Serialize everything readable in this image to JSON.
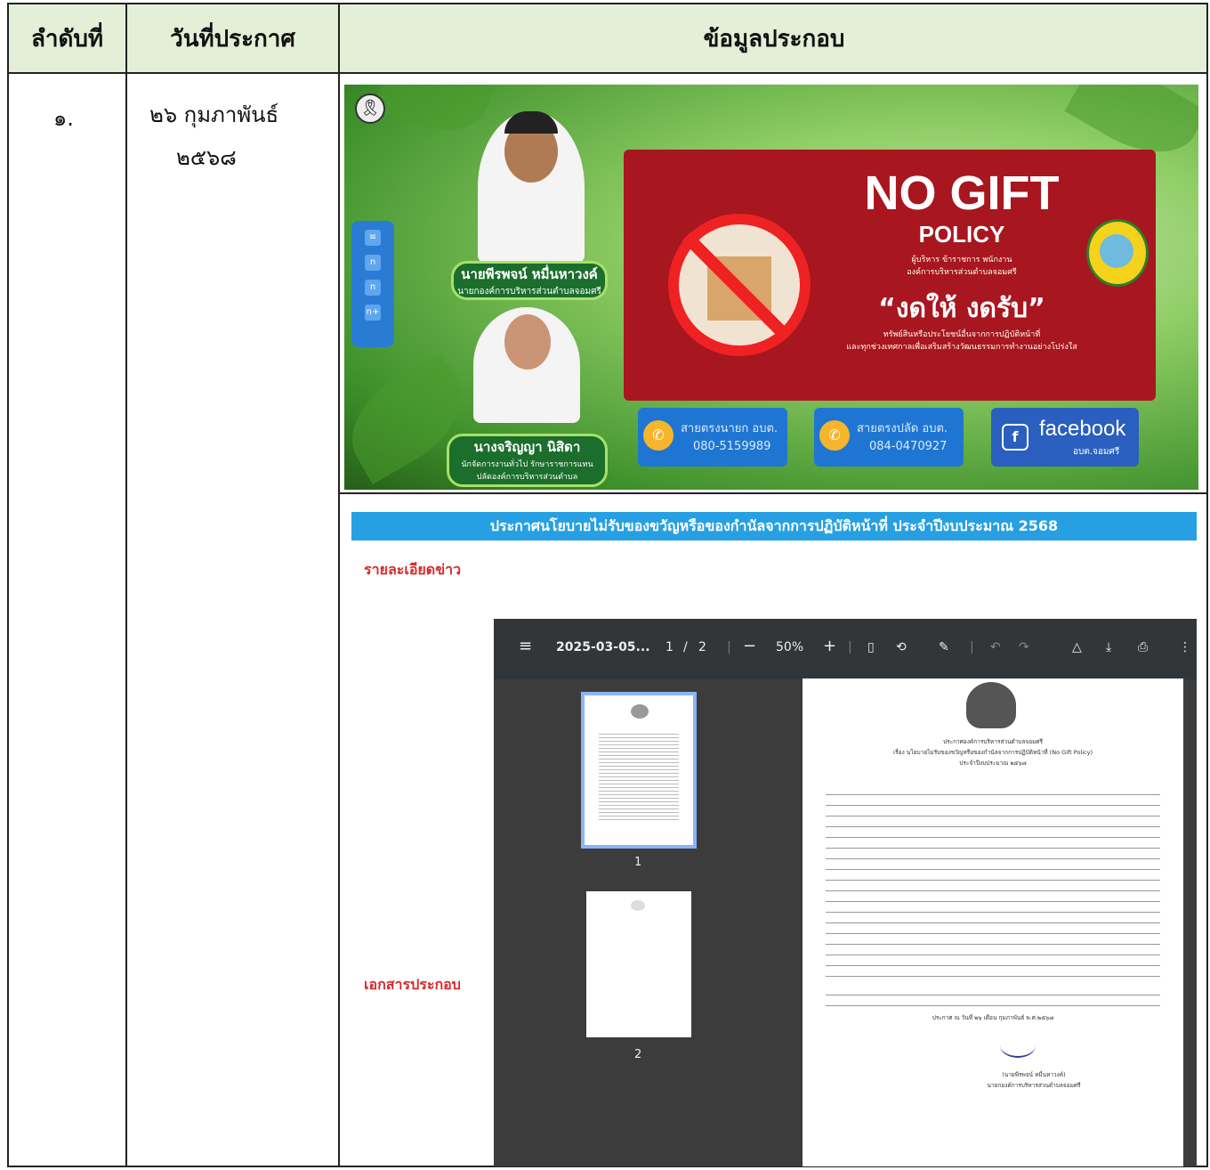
{
  "table": {
    "headers": {
      "no": "ลำดับที่",
      "date": "วันที่ประกาศ",
      "info": "ข้อมูลประกอบ"
    },
    "row": {
      "no": "๑.",
      "date_line1": "๒๖ กุมภาพันธ์",
      "date_line2": "๒๕๖๘"
    }
  },
  "banner": {
    "person1_name": "นายพีรพจน์ หมื่นหาวงค์",
    "person1_title": "นายกองค์การบริหารส่วนตำบลจอมศรี",
    "person2_name": "นางจริญญา นิสิดา",
    "person2_title1": "นักจัดการงานทั่วไป รักษาราชการแทน",
    "person2_title2": "ปลัดองค์การบริหารส่วนตำบล",
    "no_gift": "NO GIFT",
    "policy": "POLICY",
    "org_line1": "ผู้บริหาร ข้าราชการ พนักงาน",
    "org_line2": "องค์การบริหารส่วนตำบลจอมศรี",
    "slogan": "“งดให้ งดรับ”",
    "sub_line1": "ทรัพย์สินหรือประโยชน์อื่นจากการปฏิบัติหน้าที่",
    "sub_line2": "และทุกช่วงเทศกาลเพื่อเสริมสร้างวัฒนธรรมการทำงานอย่างโปร่งใส",
    "hotline1_label": "สายตรงนายก อบต.",
    "hotline1_number": "080-5159989",
    "hotline2_label": "สายตรงปลัด อบต.",
    "hotline2_number": "084-0470927",
    "facebook_label": "facebook",
    "facebook_sub": "อบต.จอมศรี"
  },
  "announcement_title": "ประกาศนโยบายไม่รับของขวัญหรือของกำนัลจากการปฏิบัติหน้าที่ ประจำปีงบประมาณ 2568",
  "news_detail_label": "รายละเอียดข่าว",
  "attachments_label": "เอกสารประกอบ",
  "pdf_viewer": {
    "filename": "2025-03-05...",
    "page_current": "1",
    "page_sep": "/",
    "page_total": "2",
    "zoom": "50%",
    "thumb1_label": "1",
    "thumb2_label": "2",
    "doc_title1": "ประกาศองค์การบริหารส่วนตำบลจอมศรี",
    "doc_title2": "เรื่อง นโยบายไม่รับของขวัญหรือของกำนัลจากการปฏิบัติหน้าที่ (No Gift Policy)",
    "doc_title3": "ประจำปีงบประมาณ ๒๕๖๘",
    "doc_date": "ประกาศ ณ วันที่ ๒๖ เดือน กุมภาพันธ์ พ.ศ.๒๕๖๘",
    "doc_signer": "(นายพีรพจน์ หมื่นหาวงค์)",
    "doc_signer_title": "นายกองค์การบริหารส่วนตำบลจอมศรี"
  }
}
